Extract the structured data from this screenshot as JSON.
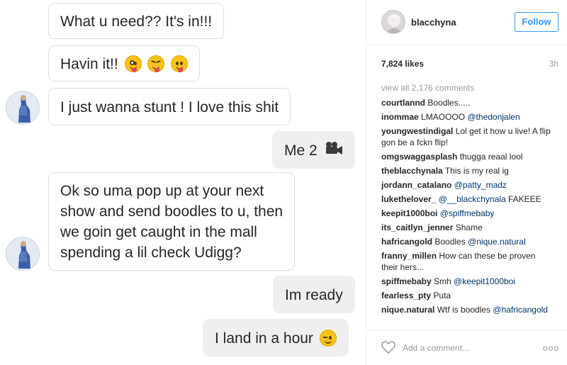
{
  "chat": {
    "messages": [
      {
        "id": 1,
        "side": "in",
        "text": "What u need?? It's in!!!"
      },
      {
        "id": 2,
        "side": "in",
        "text": "Havin it!!",
        "emojis": [
          "crazy-face-emoji",
          "squinting-tongue-emoji",
          "tongue-out-emoji"
        ]
      },
      {
        "id": 3,
        "side": "in",
        "text": "I just wanna stunt ! I love this shit"
      },
      {
        "id": 4,
        "side": "out",
        "text": "Me 2",
        "icon": "movie-camera-icon"
      },
      {
        "id": 5,
        "side": "in",
        "lines": [
          "Ok so uma pop up at your next",
          "show and send boodles to u, then",
          "we goin get caught in the mall",
          "spending a lil check Udigg?"
        ]
      },
      {
        "id": 6,
        "side": "out",
        "text": "Im ready"
      },
      {
        "id": 7,
        "side": "out",
        "text": "I land in a hour",
        "emojis": [
          "winking-face-emoji"
        ]
      }
    ]
  },
  "post": {
    "header": {
      "username": "blacchyna",
      "follow_label": "Follow"
    },
    "likes": "7,824 likes",
    "age": "3h",
    "view_all": "view all 2,176 comments",
    "comments": [
      {
        "user": "courtlannd",
        "text": "Boodles....."
      },
      {
        "user": "inommae",
        "text": "LMAOOOO ",
        "mention": "@thedonjalen"
      },
      {
        "user": "youngwestindigal",
        "text": "Lol get it how u live! A flip gon be a fckn flip!"
      },
      {
        "user": "omgswaggasplash",
        "text": "thugga reaal lool"
      },
      {
        "user": "theblacchynala",
        "text": "This is my real ig"
      },
      {
        "user": "jordann_catalano",
        "text": " ",
        "mention": "@patty_madz"
      },
      {
        "user": "lukethelover_",
        "text": " ",
        "mention": "@__blackchynala",
        "after": " FAKEEE"
      },
      {
        "user": "keepit1000boi",
        "text": " ",
        "mention": "@spiffmebaby"
      },
      {
        "user": "its_caitlyn_jenner",
        "text": "Shame"
      },
      {
        "user": "hafricangold",
        "text": "Boodles ",
        "mention": "@nique.natural"
      },
      {
        "user": "franny_millen",
        "text": "How can these be proven their hers..."
      },
      {
        "user": "spiffmebaby",
        "text": "Smh ",
        "mention": "@keepit1000boi"
      },
      {
        "user": "fearless_pty",
        "text": "Puta"
      },
      {
        "user": "nique.natural",
        "text": "Wtf is boodles ",
        "mention": "@hafricangold"
      }
    ],
    "add_comment_placeholder": "Add a comment...",
    "more_label": "ooo"
  },
  "colors": {
    "accent": "#3897f0",
    "mention": "#003569",
    "muted": "#999999",
    "bubble_out": "#efefef"
  }
}
